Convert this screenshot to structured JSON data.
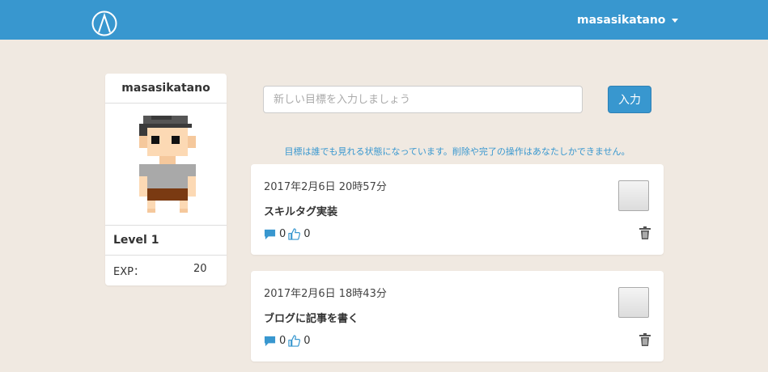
{
  "header": {
    "logo_icon": "mountain-circle-logo",
    "username": "masasikatano",
    "brand_color": "#3897cf"
  },
  "profile": {
    "name": "masasikatano",
    "avatar_icon": "pixel-person-avatar",
    "level_text": "Level 1",
    "exp_label": "EXP：",
    "exp_value": "20"
  },
  "goal_form": {
    "placeholder": "新しい目標を入力しましょう",
    "value": "",
    "submit_label": "入力"
  },
  "notice": "目標は誰でも見れる状態になっています。削除や完了の操作はあなたしかできません。",
  "goals": [
    {
      "date": "2017年2月6日 20時57分",
      "title": "スキルタグ実装",
      "comments": "0",
      "likes": "0"
    },
    {
      "date": "2017年2月6日 18時43分",
      "title": "ブログに記事を書く",
      "comments": "0",
      "likes": "0"
    }
  ]
}
